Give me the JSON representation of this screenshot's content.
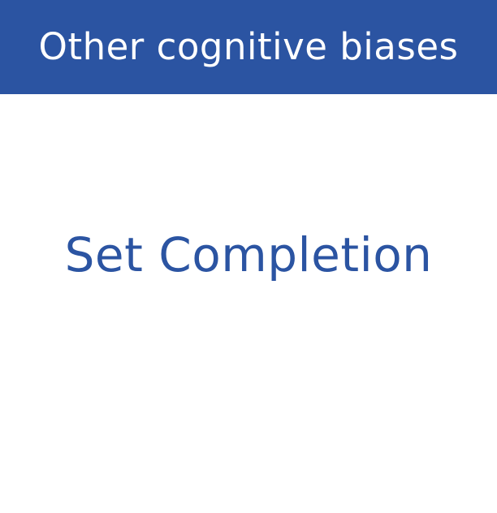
{
  "header": {
    "title": "Other cognitive biases",
    "background_color": "#2b54a2",
    "text_color": "#ffffff"
  },
  "main": {
    "text": "Set Completion",
    "text_color": "#2b54a2",
    "background_color": "#ffffff"
  }
}
